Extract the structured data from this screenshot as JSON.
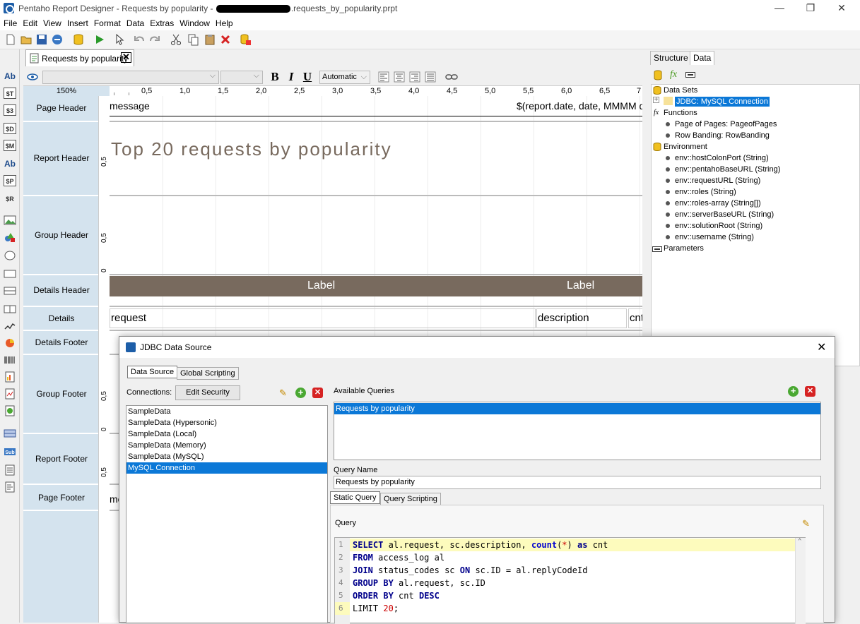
{
  "window": {
    "title_prefix": "Pentaho Report Designer - Requests by popularity - ",
    "title_suffix": ".requests_by_popularity.prpt",
    "minimize": "—",
    "maximize": "❐",
    "close": "✕"
  },
  "menu": [
    "File",
    "Edit",
    "View",
    "Insert",
    "Format",
    "Data",
    "Extras",
    "Window",
    "Help"
  ],
  "doc_tab": {
    "label": "Requests by popularity",
    "close": "✕"
  },
  "format_bar": {
    "bold": "B",
    "italic": "I",
    "underline": "U",
    "wrap_mode": "Automatic"
  },
  "zoom": "150%",
  "ruler_ticks": [
    "0,5",
    "1,0",
    "1,5",
    "2,0",
    "2,5",
    "3,0",
    "3,5",
    "4,0",
    "4,5",
    "5,0",
    "5,5",
    "6,0",
    "6,5",
    "7"
  ],
  "bands": [
    "Page Header",
    "Report Header",
    "Group Header",
    "Details Header",
    "Details",
    "Details Footer",
    "Group Footer",
    "Report Footer",
    "Page Footer"
  ],
  "vruler_marks": {
    "half": "0,5",
    "zero": "0"
  },
  "report": {
    "page_header_message": "message",
    "page_header_date": "$(report.date, date, MMMM do",
    "title": "Top 20 requests by popularity",
    "label_1": "Label",
    "label_2": "Label",
    "field_request": "request",
    "field_description": "description",
    "field_cnt": "cnt",
    "page_footer_message": "me"
  },
  "palette_icons": [
    "Ab",
    "$T",
    "$3",
    "$D",
    "$M",
    "Ab",
    "$P",
    "$R"
  ],
  "right_panel": {
    "tabs": [
      "Structure",
      "Data"
    ],
    "tree": {
      "data_sets": "Data Sets",
      "connection": "JDBC: MySQL Connection",
      "functions": "Functions",
      "function_items": [
        "Page of Pages: PageofPages",
        "Row Banding: RowBanding"
      ],
      "environment": "Environment",
      "env_items": [
        "env::hostColonPort (String)",
        "env::pentahoBaseURL (String)",
        "env::requestURL (String)",
        "env::roles (String)",
        "env::roles-array (String[])",
        "env::serverBaseURL (String)",
        "env::solutionRoot (String)",
        "env::username (String)"
      ],
      "parameters": "Parameters"
    }
  },
  "dialog": {
    "title": "JDBC Data Source",
    "close": "✕",
    "tabs": [
      "Data Source",
      "Global Scripting"
    ],
    "connections_label": "Connections:",
    "edit_security": "Edit Security",
    "connections": [
      "SampleData",
      "SampleData (Hypersonic)",
      "SampleData (Local)",
      "SampleData (Memory)",
      "SampleData (MySQL)",
      "MySQL Connection"
    ],
    "selected_connection_index": 5,
    "available_queries_label": "Available Queries",
    "queries": [
      "Requests by popularity"
    ],
    "query_name_label": "Query Name",
    "query_name_value": "Requests by popularity",
    "query_tabs": [
      "Static Query",
      "Query Scripting"
    ],
    "query_label": "Query",
    "sql_lines": [
      "SELECT al.request, sc.description, count(*) as cnt",
      "FROM access_log al",
      "JOIN status_codes sc ON sc.ID = al.replyCodeId",
      "GROUP BY al.request, sc.ID",
      "ORDER BY cnt DESC",
      "LIMIT 20;"
    ],
    "line_numbers": [
      "1",
      "2",
      "3",
      "4",
      "5",
      "6"
    ]
  },
  "colors": {
    "selection": "#0b78d7",
    "band_label_bg": "#d4e3ee",
    "header_label_bg": "#786a5e",
    "title_text": "#786a5e",
    "sql_keyword": "#00008b",
    "current_line": "#fdfbbd"
  }
}
